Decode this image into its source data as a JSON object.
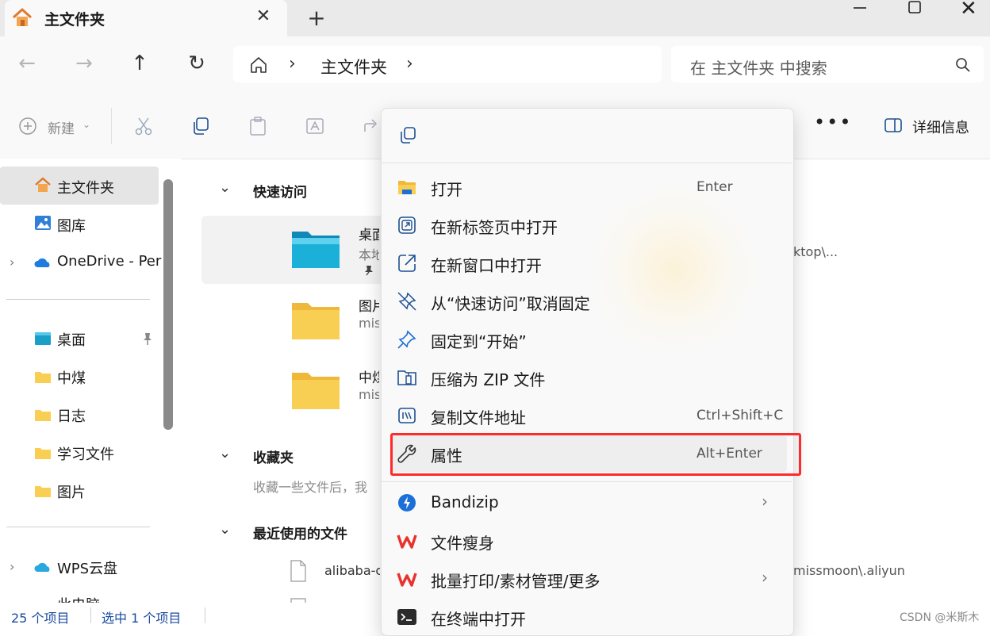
{
  "window": {
    "tab_title": "主文件夹",
    "close_tab_glyph": "✕",
    "new_tab_glyph": "+",
    "close_glyph": "✕"
  },
  "nav": {
    "back_glyph": "←",
    "forward_glyph": "→",
    "up_glyph": "↑",
    "refresh_glyph": "↻",
    "breadcrumb_sep": "›",
    "breadcrumb_current": "主文件夹",
    "search_placeholder": "在 主文件夹 中搜索"
  },
  "toolbar": {
    "new_label": "新建",
    "new_chevron": "⌄",
    "more_glyph": "•••",
    "details_label": "详细信息"
  },
  "sidebar": {
    "expander_glyph": "›",
    "items": [
      {
        "label": "主文件夹",
        "icon": "home-icon"
      },
      {
        "label": "图库",
        "icon": "gallery-icon"
      },
      {
        "label": "OneDrive - Per",
        "icon": "onedrive-icon"
      },
      {
        "label": "桌面",
        "icon": "desktop-folder-icon"
      },
      {
        "label": "中煤",
        "icon": "folder-icon"
      },
      {
        "label": "日志",
        "icon": "folder-icon"
      },
      {
        "label": "学习文件",
        "icon": "folder-icon"
      },
      {
        "label": "图片",
        "icon": "folder-icon"
      },
      {
        "label": "WPS云盘",
        "icon": "wps-cloud-icon"
      },
      {
        "label": "此电脑",
        "icon": "computer-icon"
      }
    ]
  },
  "main": {
    "section_chevron": "⌄",
    "quick_access_title": "快速访问",
    "favorites_title": "收藏夹",
    "favorites_hint": "收藏一些文件后，我",
    "recent_title": "最近使用的文件",
    "quick_items": [
      {
        "name": "桌面",
        "sub": "本地"
      },
      {
        "name": "图片",
        "sub": "miss"
      },
      {
        "name": "中煤",
        "sub": "miss"
      }
    ],
    "recent_file_name": "alibaba-c",
    "right_path_1": "ktop\\...",
    "right_path_recent": "missmoon\\.aliyun"
  },
  "context_menu": {
    "submenu_arrow": "›",
    "items": [
      {
        "label": "打开",
        "shortcut": "Enter",
        "icon": "folder-open-icon"
      },
      {
        "label": "在新标签页中打开",
        "shortcut": "",
        "icon": "new-tab-icon"
      },
      {
        "label": "在新窗口中打开",
        "shortcut": "",
        "icon": "new-window-icon"
      },
      {
        "label": "从“快速访问”取消固定",
        "shortcut": "",
        "icon": "unpin-icon"
      },
      {
        "label": "固定到“开始”",
        "shortcut": "",
        "icon": "pin-icon"
      },
      {
        "label": "压缩为 ZIP 文件",
        "shortcut": "",
        "icon": "zip-icon"
      },
      {
        "label": "复制文件地址",
        "shortcut": "Ctrl+Shift+C",
        "icon": "copy-path-icon"
      },
      {
        "label": "属性",
        "shortcut": "Alt+Enter",
        "icon": "wrench-icon"
      },
      {
        "label": "Bandizip",
        "shortcut": "",
        "icon": "bandizip-icon"
      },
      {
        "label": "文件瘦身",
        "shortcut": "",
        "icon": "wps-icon"
      },
      {
        "label": "批量打印/素材管理/更多",
        "shortcut": "",
        "icon": "wps-icon"
      },
      {
        "label": "在终端中打开",
        "shortcut": "",
        "icon": "terminal-icon"
      }
    ]
  },
  "status": {
    "items_count": "25 个项目",
    "selected": "选中 1 个项目"
  },
  "watermark": "CSDN @米斯木",
  "colors": {
    "highlight_border": "#ff2a2a",
    "accent_blue": "#0a64c8",
    "folder_yellow": "#f8cf52",
    "wps_red": "#e8322e"
  }
}
